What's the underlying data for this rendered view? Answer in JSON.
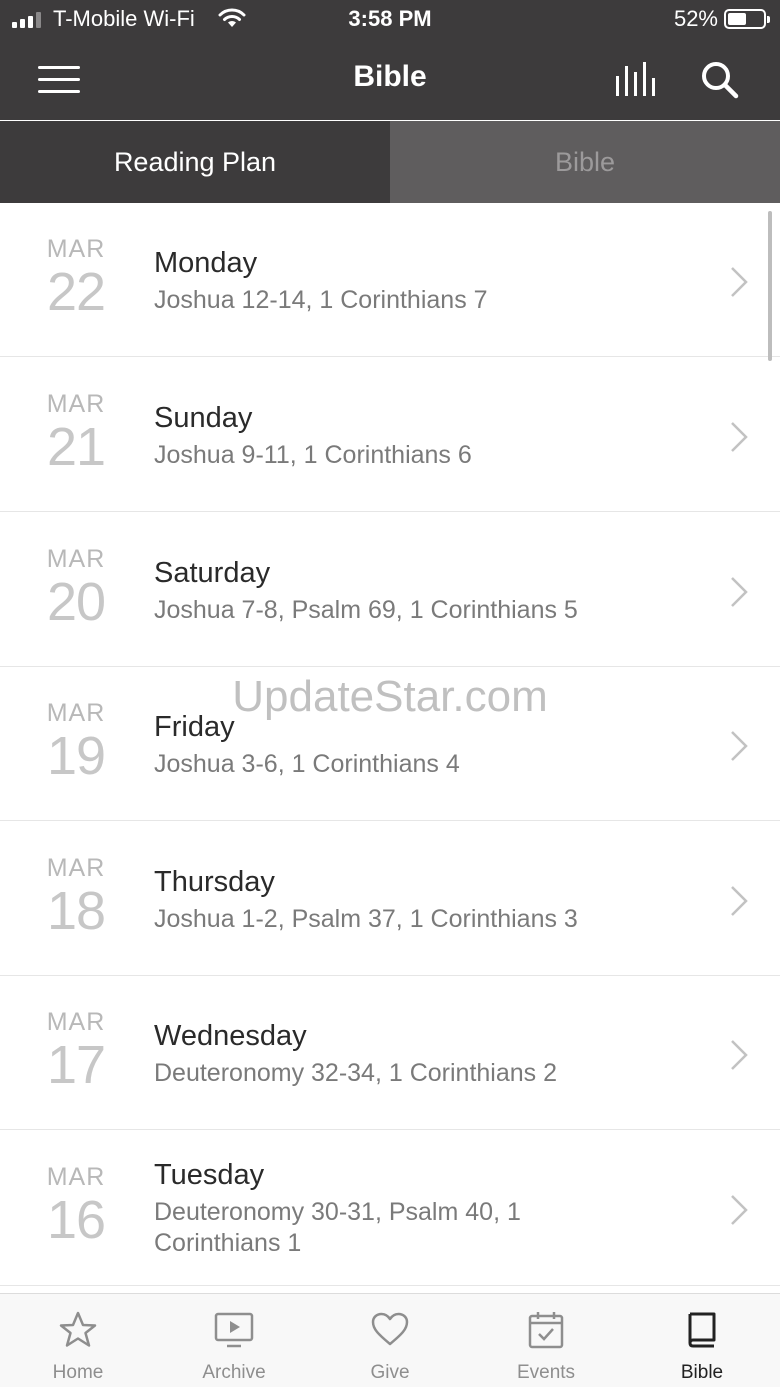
{
  "status_bar": {
    "carrier": "T-Mobile Wi-Fi",
    "time": "3:58 PM",
    "battery": "52%"
  },
  "nav": {
    "title": "Bible",
    "icons": [
      "menu-icon",
      "bar-chart-icon",
      "search-icon"
    ]
  },
  "tabs": [
    {
      "label": "Reading Plan",
      "active": true
    },
    {
      "label": "Bible",
      "active": false
    }
  ],
  "readings": [
    {
      "month": "MAR",
      "day": "22",
      "weekday": "Monday",
      "passages": "Joshua 12-14, 1 Corinthians 7"
    },
    {
      "month": "MAR",
      "day": "21",
      "weekday": "Sunday",
      "passages": "Joshua 9-11, 1 Corinthians 6"
    },
    {
      "month": "MAR",
      "day": "20",
      "weekday": "Saturday",
      "passages": "Joshua 7-8, Psalm 69, 1 Corinthians 5"
    },
    {
      "month": "MAR",
      "day": "19",
      "weekday": "Friday",
      "passages": "Joshua 3-6, 1 Corinthians 4"
    },
    {
      "month": "MAR",
      "day": "18",
      "weekday": "Thursday",
      "passages": "Joshua 1-2, Psalm 37, 1 Corinthians 3"
    },
    {
      "month": "MAR",
      "day": "17",
      "weekday": "Wednesday",
      "passages": "Deuteronomy 32-34, 1 Corinthians 2"
    },
    {
      "month": "MAR",
      "day": "16",
      "weekday": "Tuesday",
      "passages": "Deuteronomy 30-31, Psalm 40, 1 Corinthians 1"
    }
  ],
  "watermark": "UpdateStar.com",
  "tab_bar": [
    {
      "label": "Home",
      "icon": "star-icon",
      "selected": false
    },
    {
      "label": "Archive",
      "icon": "play-screen-icon",
      "selected": false
    },
    {
      "label": "Give",
      "icon": "heart-icon",
      "selected": false
    },
    {
      "label": "Events",
      "icon": "calendar-check-icon",
      "selected": false
    },
    {
      "label": "Bible",
      "icon": "book-icon",
      "selected": true
    }
  ],
  "colors": {
    "header": "#3d3b3c",
    "inactive_tab": "#5f5d5e",
    "muted_text": "#7a7a7a"
  }
}
